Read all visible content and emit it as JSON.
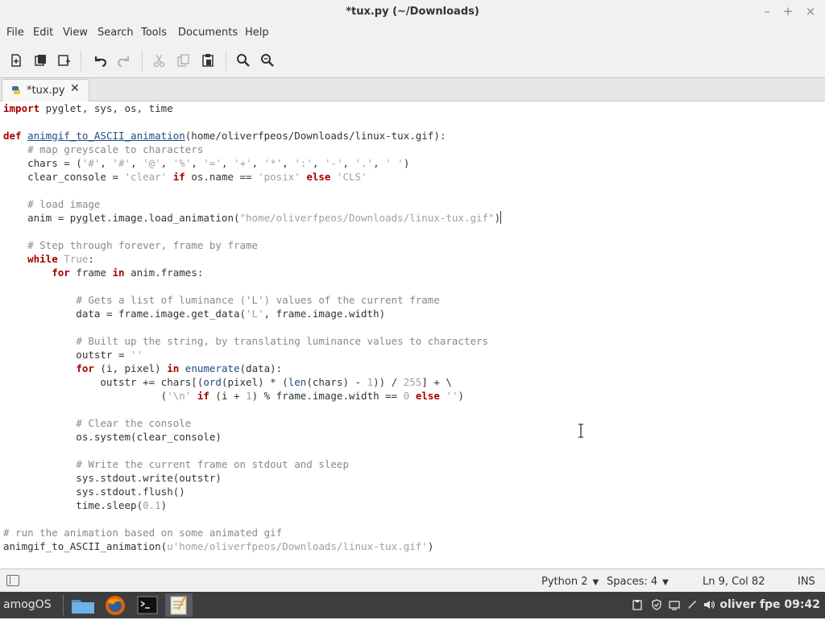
{
  "window": {
    "title": "*tux.py (~/Downloads)",
    "minimize_glyph": "–",
    "maximize_glyph": "+",
    "close_glyph": "×"
  },
  "menubar": {
    "items": [
      "File",
      "Edit",
      "View",
      "Search",
      "Tools",
      "Documents",
      "Help"
    ]
  },
  "toolbar": {
    "icons": [
      "new-document-icon",
      "open-document-icon",
      "save-document-icon",
      "undo-icon",
      "redo-icon",
      "cut-icon",
      "copy-icon",
      "paste-icon",
      "find-icon",
      "find-replace-icon"
    ]
  },
  "tab": {
    "label": "*tux.py",
    "close_glyph": "✕",
    "icon": "python-file-icon"
  },
  "editor": {
    "cursor": {
      "line": 9,
      "col": 82
    },
    "lines": [
      [
        [
          "kw",
          "import"
        ],
        [
          "tx",
          " pyglet, sys, os, time"
        ]
      ],
      [],
      [
        [
          "kw",
          "def"
        ],
        [
          "tx",
          " "
        ],
        [
          "fn",
          "animgif_to_ASCII_animation"
        ],
        [
          "tx",
          "(home/oliverfpeos/Downloads/linux-tux.gif):"
        ]
      ],
      [
        [
          "tx",
          "    "
        ],
        [
          "cm",
          "# map greyscale to characters"
        ]
      ],
      [
        [
          "tx",
          "    chars = ("
        ],
        [
          "str",
          "'#'"
        ],
        [
          "tx",
          ", "
        ],
        [
          "str",
          "'#'"
        ],
        [
          "tx",
          ", "
        ],
        [
          "str",
          "'@'"
        ],
        [
          "tx",
          ", "
        ],
        [
          "str",
          "'%'"
        ],
        [
          "tx",
          ", "
        ],
        [
          "str",
          "'='"
        ],
        [
          "tx",
          ", "
        ],
        [
          "str",
          "'+'"
        ],
        [
          "tx",
          ", "
        ],
        [
          "str",
          "'*'"
        ],
        [
          "tx",
          ", "
        ],
        [
          "str",
          "':'"
        ],
        [
          "tx",
          ", "
        ],
        [
          "str",
          "'-'"
        ],
        [
          "tx",
          ", "
        ],
        [
          "str",
          "'.'"
        ],
        [
          "tx",
          ", "
        ],
        [
          "str",
          "' '"
        ],
        [
          "tx",
          ")"
        ]
      ],
      [
        [
          "tx",
          "    clear_console = "
        ],
        [
          "str",
          "'clear'"
        ],
        [
          "tx",
          " "
        ],
        [
          "kw",
          "if"
        ],
        [
          "tx",
          " os.name == "
        ],
        [
          "str",
          "'posix'"
        ],
        [
          "tx",
          " "
        ],
        [
          "kw",
          "else"
        ],
        [
          "tx",
          " "
        ],
        [
          "str",
          "'CLS'"
        ]
      ],
      [],
      [
        [
          "tx",
          "    "
        ],
        [
          "cm",
          "# load image"
        ]
      ],
      [
        [
          "tx",
          "    anim = pyglet.image.load_animation("
        ],
        [
          "str",
          "\"home/oliverfpeos/Downloads/linux-tux.gif\""
        ],
        [
          "tx",
          ")"
        ]
      ],
      [],
      [
        [
          "tx",
          "    "
        ],
        [
          "cm",
          "# Step through forever, frame by frame"
        ]
      ],
      [
        [
          "tx",
          "    "
        ],
        [
          "kw",
          "while"
        ],
        [
          "tx",
          " "
        ],
        [
          "str",
          "True"
        ],
        [
          "tx",
          ":"
        ]
      ],
      [
        [
          "tx",
          "        "
        ],
        [
          "kw",
          "for"
        ],
        [
          "tx",
          " frame "
        ],
        [
          "kw",
          "in"
        ],
        [
          "tx",
          " anim.frames:"
        ]
      ],
      [],
      [
        [
          "tx",
          "            "
        ],
        [
          "cm",
          "# Gets a list of luminance ('L') values of the current frame"
        ]
      ],
      [
        [
          "tx",
          "            data = frame.image.get_data("
        ],
        [
          "str",
          "'L'"
        ],
        [
          "tx",
          ", frame.image.width)"
        ]
      ],
      [],
      [
        [
          "tx",
          "            "
        ],
        [
          "cm",
          "# Built up the string, by translating luminance values to characters"
        ]
      ],
      [
        [
          "tx",
          "            outstr = "
        ],
        [
          "str",
          "''"
        ]
      ],
      [
        [
          "tx",
          "            "
        ],
        [
          "kw",
          "for"
        ],
        [
          "tx",
          " (i, pixel) "
        ],
        [
          "kw",
          "in"
        ],
        [
          "tx",
          " "
        ],
        [
          "bi",
          "enumerate"
        ],
        [
          "tx",
          "(data):"
        ]
      ],
      [
        [
          "tx",
          "                outstr += chars[("
        ],
        [
          "bi",
          "ord"
        ],
        [
          "tx",
          "(pixel) * ("
        ],
        [
          "bi",
          "len"
        ],
        [
          "tx",
          "(chars) - "
        ],
        [
          "num",
          "1"
        ],
        [
          "tx",
          ")) / "
        ],
        [
          "num",
          "255"
        ],
        [
          "tx",
          "] + \\"
        ]
      ],
      [
        [
          "tx",
          "                          ("
        ],
        [
          "str",
          "'\\n'"
        ],
        [
          "tx",
          " "
        ],
        [
          "kw",
          "if"
        ],
        [
          "tx",
          " (i + "
        ],
        [
          "num",
          "1"
        ],
        [
          "tx",
          ") % frame.image.width == "
        ],
        [
          "num",
          "0"
        ],
        [
          "tx",
          " "
        ],
        [
          "kw",
          "else"
        ],
        [
          "tx",
          " "
        ],
        [
          "str",
          "''"
        ],
        [
          "tx",
          ")"
        ]
      ],
      [],
      [
        [
          "tx",
          "            "
        ],
        [
          "cm",
          "# Clear the console"
        ]
      ],
      [
        [
          "tx",
          "            os.system(clear_console)"
        ]
      ],
      [],
      [
        [
          "tx",
          "            "
        ],
        [
          "cm",
          "# Write the current frame on stdout and sleep"
        ]
      ],
      [
        [
          "tx",
          "            sys.stdout.write(outstr)"
        ]
      ],
      [
        [
          "tx",
          "            sys.stdout.flush()"
        ]
      ],
      [
        [
          "tx",
          "            time.sleep("
        ],
        [
          "num",
          "0.1"
        ],
        [
          "tx",
          ")"
        ]
      ],
      [],
      [
        [
          "cm",
          "# run the animation based on some animated gif"
        ]
      ],
      [
        [
          "tx",
          "animgif_to_ASCII_animation("
        ],
        [
          "str",
          "u'home/oliverfpeos/Downloads/linux-tux.gif'"
        ],
        [
          "tx",
          ")"
        ]
      ]
    ]
  },
  "statusbar": {
    "language": "Python 2",
    "spaces": "Spaces: 4",
    "position": "Ln 9, Col 82",
    "mode": "INS"
  },
  "taskbar": {
    "start_label": "amogOS",
    "apps": [
      "file-manager-icon",
      "firefox-icon",
      "terminal-icon",
      "text-editor-icon"
    ],
    "tray_icons": [
      "clipboard-icon",
      "shield-icon",
      "display-icon",
      "pen-icon",
      "volume-icon"
    ],
    "user_clock": "oliver fpe 09:42"
  },
  "colors": {
    "keyword": "#a40000",
    "function": "#204a87",
    "string": "#a0a0a0",
    "comment": "#888a85",
    "panel": "#f2f1f0",
    "taskbar": "#3b3d3f"
  }
}
